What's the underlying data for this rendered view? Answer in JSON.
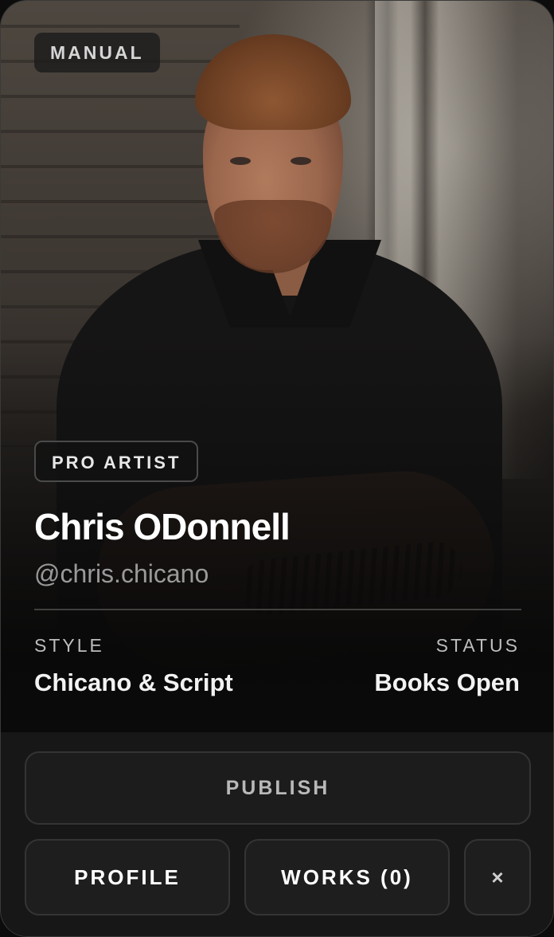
{
  "card": {
    "mode_badge": "MANUAL",
    "tier_badge": "PRO ARTIST",
    "name": "Chris ODonnell",
    "handle": "@chris.chicano",
    "style_label": "STYLE",
    "style_value": "Chicano & Script",
    "status_label": "STATUS",
    "status_value": "Books Open"
  },
  "actions": {
    "publish_label": "PUBLISH",
    "profile_label": "PROFILE",
    "works_label": "WORKS (0)",
    "close_label": "×"
  },
  "photo": {
    "subject": "artist-portrait"
  }
}
